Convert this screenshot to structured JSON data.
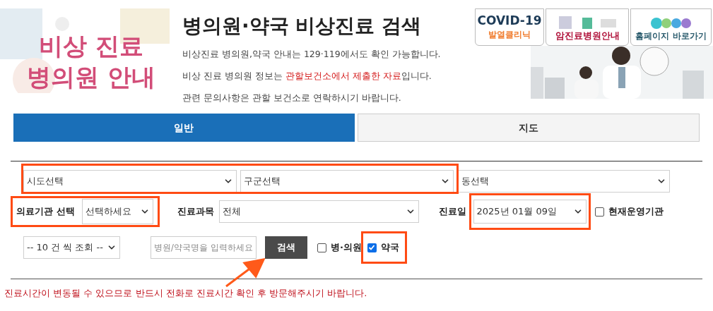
{
  "header": {
    "logo_lines": [
      "비상 진료",
      "병의원 안내"
    ],
    "title": "병의원·약국 비상진료 검색",
    "notices": [
      "비상진료 병의원,약국 안내는 129·119에서도 확인 가능합니다.",
      "비상 진료 병의원 정보는 **관할보건소에서 제출한 자료**입니다.",
      "관련 문의사항은 관할 보건소로 연락하시기 바랍니다."
    ],
    "banners": [
      {
        "kind": "covid",
        "title": "COVID-19",
        "subtitle": "발열클리닉"
      },
      {
        "kind": "cancer",
        "title": "암진료병원안내"
      },
      {
        "kind": "homepage",
        "title": "홈페이지 바로가기"
      }
    ]
  },
  "tabs": [
    {
      "label": "일반",
      "selected": true
    },
    {
      "label": "지도",
      "selected": false
    }
  ],
  "filters": {
    "region": {
      "highlighted": true,
      "selects": [
        "시도선택",
        "구군선택"
      ]
    },
    "dong_select": "동선택",
    "institution": {
      "label": "의료기관 선택",
      "value": "선택하세요",
      "highlighted": true
    },
    "department": {
      "label": "진료과목",
      "value": "전체"
    },
    "date": {
      "label": "진료일",
      "value": "2025년 01월 09일",
      "highlighted": true
    },
    "open_now": {
      "label": "현재운영기관",
      "checked": false
    },
    "page_size": "-- 10 건 씩 조회 --",
    "search_input": {
      "placeholder": "병원/약국명을 입력하세요"
    },
    "search_button": {
      "label": "검색",
      "pointed": true
    },
    "types": [
      {
        "label": "병·의원",
        "checked": false,
        "highlighted": false
      },
      {
        "label": "약국",
        "checked": true,
        "highlighted": true
      }
    ]
  },
  "note": "진료시간이 변동될 수 있으므로 반드시 전화로 진료시간 확인 후 방문해주시기 바랍니다."
}
